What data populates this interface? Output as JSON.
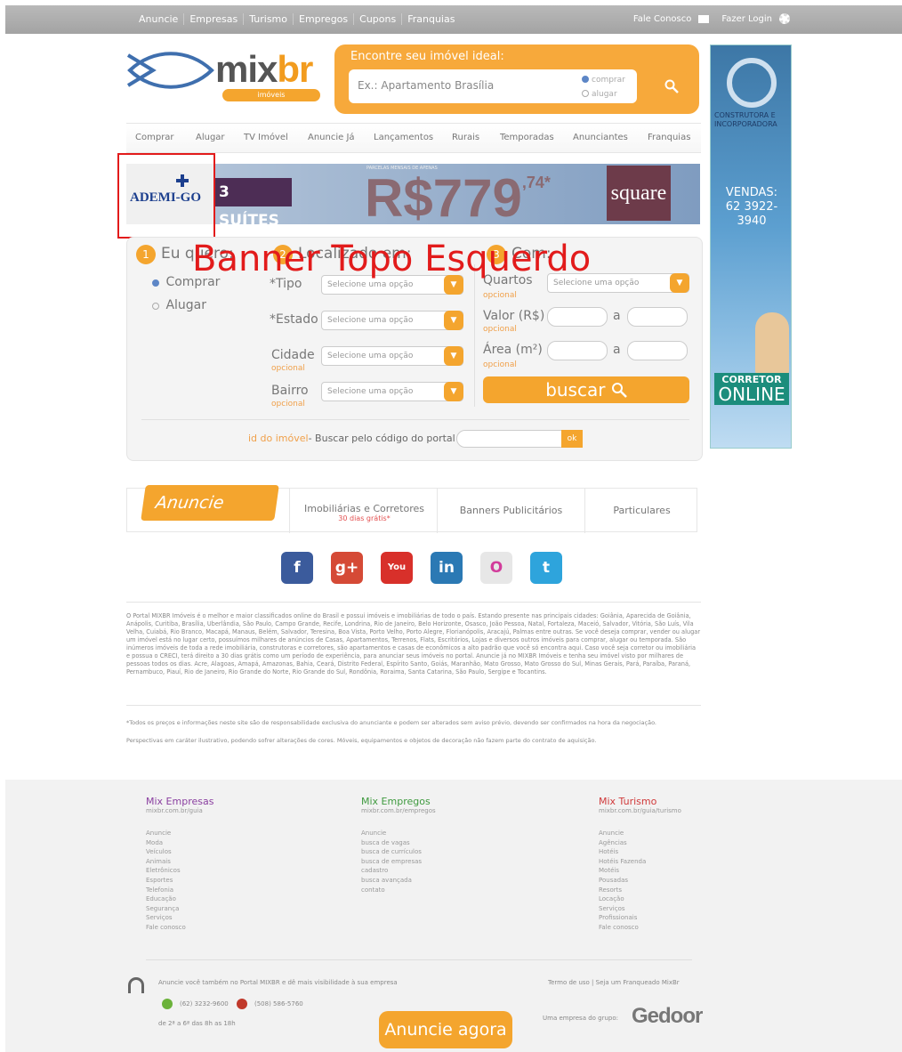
{
  "topbar": {
    "nav": [
      "Anuncie",
      "Empresas",
      "Turismo",
      "Empregos",
      "Cupons",
      "Franquias"
    ],
    "contact": "Fale Conosco",
    "login": "Fazer Login"
  },
  "logo": {
    "word_a": "mix",
    "word_b": "br",
    "sub": "imóveis"
  },
  "search": {
    "title": "Encontre seu imóvel ideal:",
    "placeholder": "Ex.: Apartamento Brasília",
    "radio_buy": "comprar",
    "radio_rent": "alugar"
  },
  "menu": [
    "Comprar",
    "Alugar",
    "TV Imóvel",
    "Anuncie Já",
    "Lançamentos",
    "Rurais",
    "Temporadas",
    "Anunciantes",
    "Franquias"
  ],
  "banner": {
    "ademi": "ADEMI-GO",
    "suites": "3 SUÍTES",
    "parcelas": "PARCELAS MENSAIS DE APENAS",
    "price": "R$779",
    "cents": ",74*",
    "square": "square"
  },
  "overlay_label": "Banner Topo Esquerdo",
  "right_banner": {
    "company": "CONSTRUTORA E INCORPORADORA",
    "vendas": "VENDAS:",
    "phone": "62 3922-3940",
    "corretor": "CORRETOR",
    "online": "ONLINE"
  },
  "form": {
    "step1": {
      "num": "1",
      "title": "Eu quero:",
      "buy": "Comprar",
      "rent": "Alugar"
    },
    "step2": {
      "num": "2",
      "title": "Localizado em:",
      "tipo": "*Tipo",
      "estado": "*Estado",
      "cidade": "Cidade",
      "bairro": "Bairro",
      "optional": "opcional",
      "select_placeholder": "Selecione uma opção"
    },
    "step3": {
      "num": "3",
      "title": "Com:",
      "quartos": "Quartos",
      "valor": "Valor (R$)",
      "area": "Área (m²)",
      "a": "a",
      "optional": "opcional"
    },
    "buscar": "buscar",
    "id_label": "id do imóvel",
    "id_text": "- Buscar pelo código do portal",
    "ok": "ok"
  },
  "anuncie": {
    "tag": "Anuncie",
    "imobiliarias": "Imobiliárias e Corretores",
    "gratis": "30 dias grátis*",
    "banners": "Banners Publicitários",
    "particulares": "Particulares"
  },
  "social": [
    {
      "label": "f",
      "color": "#3b5b9c"
    },
    {
      "label": "g+",
      "color": "#d54a36"
    },
    {
      "label": "You",
      "color": "#d8302a"
    },
    {
      "label": "in",
      "color": "#2b79b4"
    },
    {
      "label": "O",
      "color": "#e7e7e7"
    },
    {
      "label": "t",
      "color": "#2ea4dc"
    }
  ],
  "about": "O Portal MIXBR Imóveis é o melhor e maior classificados online do Brasil e possui imóveis e imobiliárias de todo o país. Estando presente nas principais cidades: Goiânia, Aparecida de Goiânia, Anápolis, Curitiba, Brasília, Uberlândia, São Paulo, Campo Grande, Recife, Londrina, Rio de Janeiro, Belo Horizonte, Osasco, João Pessoa, Natal, Fortaleza, Maceió, Salvador, Vitória, São Luís, Vila Velha, Cuiabá, Rio Branco, Macapá, Manaus, Belém, Salvador, Teresina, Boa Vista, Porto Velho, Porto Alegre, Florianópolis, Aracajú, Palmas entre outras. Se você deseja comprar, vender ou alugar um imóvel está no lugar certo, possuímos milhares de anúncios de Casas, Apartamentos, Terrenos, Flats, Escritórios, Lojas e diversos outros imóveis para comprar, alugar ou temporada. São inúmeros imóveis de toda a rede imobiliária, construtoras e corretores, são apartamentos e casas de econômicos a alto padrão que você só encontra aqui. Caso você seja corretor ou imobiliária e possua o CRECI, terá direito a 30 dias grátis como um período de experiência, para anunciar seus imóveis no portal. Anuncie já no MIXBR Imóveis e tenha seu imóvel visto por milhares de pessoas todos os dias. Acre, Alagoas, Amapá, Amazonas, Bahia, Ceará, Distrito Federal, Espírito Santo, Goiás, Maranhão, Mato Grosso, Mato Grosso do Sul, Minas Gerais, Pará, Paraíba, Paraná, Pernambuco, Piauí, Rio de Janeiro, Rio Grande do Norte, Rio Grande do Sul, Rondônia, Roraima, Santa Catarina, São Paulo, Sergipe e Tocantins.",
  "disclaimer1": "*Todos os preços e informações neste site são de responsabilidade exclusiva do anunciante e podem ser alterados sem aviso prévio, devendo ser confirmados na hora da negociação.",
  "disclaimer2": "Perspectivas em caráter ilustrativo, podendo sofrer alterações de cores. Móveis, equipamentos e objetos de decoração não fazem parte do contrato de aquisição.",
  "footer": {
    "empresas": {
      "title": "Mix Empresas",
      "url": "mixbr.com.br/guia",
      "color": "#8a3fa0",
      "items": [
        "Anuncie",
        "Moda",
        "Veículos",
        "Animais",
        "Eletrônicos",
        "Esportes",
        "Telefonia",
        "Educação",
        "Segurança",
        "Serviços",
        "Fale conosco"
      ]
    },
    "empregos": {
      "title": "Mix Empregos",
      "url": "mixbr.com.br/empregos",
      "color": "#3f9a3f",
      "items": [
        "Anuncie",
        "busca de vagas",
        "busca de currículos",
        "busca de empresas",
        "cadastro",
        "busca avançada",
        "contato"
      ]
    },
    "turismo": {
      "title": "Mix Turismo",
      "url": "mixbr.com.br/guia/turismo",
      "color": "#d0393a",
      "items": [
        "Anuncie",
        "Agências",
        "Hotéis",
        "Hotéis Fazenda",
        "Motéis",
        "Pousadas",
        "Resorts",
        "Locação",
        "Serviços",
        "Profissionais",
        "Fale conosco"
      ]
    },
    "anuncie_line": "Anuncie você também no Portal MIXBR e dê mais visibilidade à sua empresa",
    "phone_br": "(62) 3232-9600",
    "phone_us": "(508) 586-5760",
    "hours": "de 2ª a 6ª das 8h as 18h",
    "terms": "Termo de uso  |  Seja um Franqueado MixBr",
    "group": "Uma empresa do grupo:",
    "gedoor": "Gedoor",
    "anuncie_btn": "Anuncie agora"
  }
}
